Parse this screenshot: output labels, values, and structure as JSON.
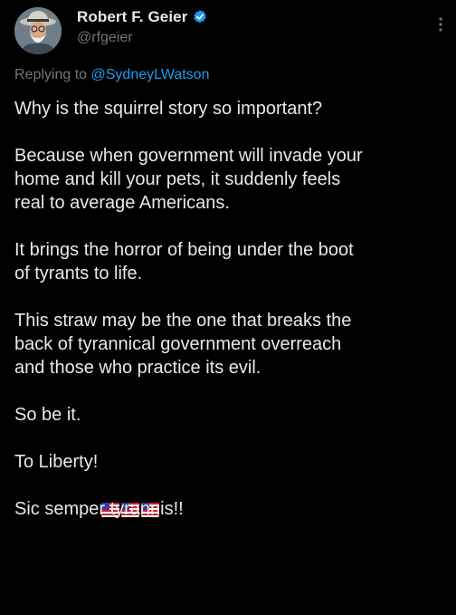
{
  "author": {
    "display_name": "Robert F. Geier",
    "handle": "@rfgeier",
    "verified": true,
    "verified_color": "#1d9bf0"
  },
  "reply": {
    "prefix": "Replying to ",
    "mention": "@SydneyLWatson"
  },
  "body": {
    "p1": "Why is the squirrel story so important?",
    "p2": "Because when government will invade your\nhome and kill your pets, it suddenly feels\nreal to average Americans.",
    "p3": "It brings the horror of being under the boot\nof tyrants to life.",
    "p4": "This straw may be the one that breaks the\nback of tyrannical government overreach\nand those who practice its evil.",
    "p5": "So be it.",
    "p6": "To Liberty!",
    "p7": "Sic semper tyrannis!!"
  },
  "icons": {
    "flag_count": 3,
    "flag_name": "us-flag-icon",
    "more": "more-vertical-icon"
  },
  "colors": {
    "background": "#000000",
    "text": "#e7e9ea",
    "secondary": "#71767b",
    "accent": "#1d9bf0"
  }
}
